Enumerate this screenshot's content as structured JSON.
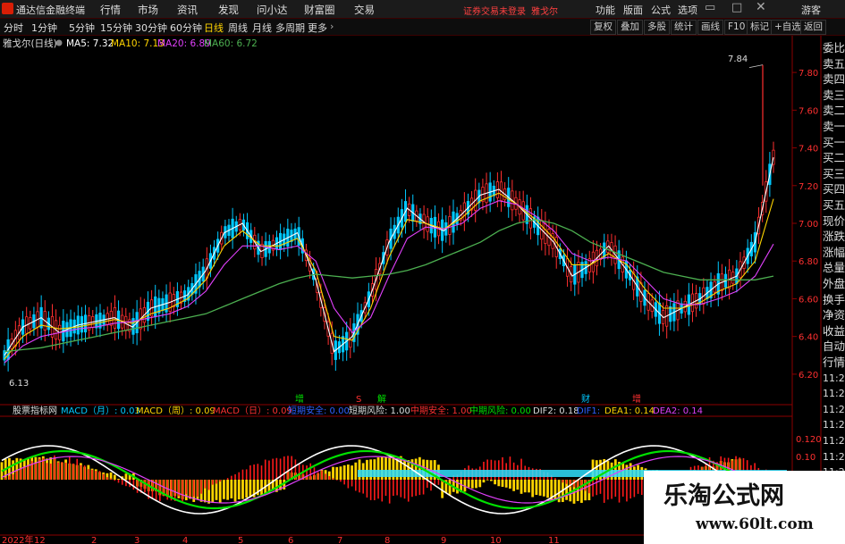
{
  "app": {
    "name": "通达信金融终端"
  },
  "menu": [
    "行情",
    "市场",
    "资讯",
    "发现",
    "问小达",
    "财富圈",
    "交易"
  ],
  "notice": "证券交易未登录",
  "stock_name_top": "雅戈尔",
  "right_menu": [
    "功能",
    "版面",
    "公式",
    "选项"
  ],
  "guest": "游客",
  "periods": [
    "分时",
    "1分钟",
    "5分钟",
    "15分钟",
    "30分钟",
    "60分钟",
    "日线",
    "周线",
    "月线",
    "多周期",
    "更多"
  ],
  "active_period": "日线",
  "tools": [
    "复权",
    "叠加",
    "多股",
    "统计",
    "画线",
    "F10",
    "标记",
    "+自选",
    "返回"
  ],
  "main_legend": {
    "title": "雅戈尔(日线)",
    "ma5": "MA5: 7.32",
    "ma10": "MA10: 7.13",
    "ma20": "MA20: 6.89",
    "ma60": "MA60: 6.72"
  },
  "colors": {
    "ma5": "#ffffff",
    "ma10": "#ffd400",
    "ma20": "#e040fb",
    "ma60": "#4caf50",
    "up": "#ff3030",
    "down": "#00c8ff",
    "accent": "#ff3030"
  },
  "price_axis": [
    "7.80",
    "7.60",
    "7.40",
    "7.20",
    "7.00",
    "6.80",
    "6.60",
    "6.40",
    "6.20"
  ],
  "high_label": "7.84",
  "low_label": "6.13",
  "event_markers": [
    {
      "text": "增",
      "color": "#00e000"
    },
    {
      "text": "S",
      "color": "#ff3030"
    },
    {
      "text": "解",
      "color": "#00e000"
    },
    {
      "text": "财",
      "color": "#00c8ff"
    },
    {
      "text": "增",
      "color": "#ff3030"
    }
  ],
  "sub_legend": {
    "title": "股票指标网",
    "items": [
      {
        "text": "MACD（月）: 0.03",
        "color": "#00c8ff"
      },
      {
        "text": "MACD（周）: 0.09",
        "color": "#ffd400"
      },
      {
        "text": "MACD（日）: 0.09",
        "color": "#ff3030"
      },
      {
        "text": "短期安全: 0.00",
        "color": "#3060ff"
      },
      {
        "text": "短期风险: 1.00",
        "color": "#dddddd"
      },
      {
        "text": "中期安全: 1.00",
        "color": "#ff3030"
      },
      {
        "text": "中期风险: 0.00",
        "color": "#00e000"
      },
      {
        "text": "DIF2: 0.18",
        "color": "#dddddd"
      },
      {
        "text": "DIF1: ",
        "color": "#3060ff"
      },
      {
        "text": "DEA1: 0.14",
        "color": "#ffd400"
      },
      {
        "text": "DEA2: 0.14",
        "color": "#e040fb"
      }
    ]
  },
  "sub_axis": [
    "0.120",
    "0.10"
  ],
  "right_quote_labels": [
    "委比",
    "卖五",
    "卖四",
    "卖三",
    "卖二",
    "卖一",
    "买一",
    "买二",
    "买三",
    "买四",
    "买五",
    "现价",
    "涨跌",
    "涨幅",
    "总量",
    "外盘",
    "换手",
    "净资",
    "收益",
    "自动",
    "行情",
    "11:29",
    "11:29",
    "11:29",
    "11:29",
    "11:29",
    "11:29",
    "11:29",
    "11:29",
    "11:29",
    "11:29"
  ],
  "date_axis": [
    "2022年",
    "12",
    "2",
    "3",
    "4",
    "5",
    "6",
    "7",
    "8",
    "9",
    "10",
    "11"
  ],
  "watermark": {
    "title": "乐淘公式网",
    "url": "www.60lt.com"
  },
  "chart_data": {
    "type": "line",
    "title": "雅戈尔(日线)",
    "ylim": [
      6.1,
      7.9
    ],
    "series": [
      {
        "name": "MA5",
        "values": [
          6.3,
          6.45,
          6.5,
          6.42,
          6.46,
          6.48,
          6.5,
          6.45,
          6.55,
          6.58,
          6.62,
          6.75,
          6.95,
          7.0,
          6.85,
          6.9,
          6.95,
          6.7,
          6.32,
          6.4,
          6.62,
          6.9,
          7.08,
          7.0,
          6.96,
          7.05,
          7.15,
          7.18,
          7.1,
          7.0,
          6.9,
          6.72,
          6.78,
          6.88,
          6.75,
          6.6,
          6.5,
          6.55,
          6.6,
          6.68,
          6.72,
          6.9,
          7.35
        ]
      },
      {
        "name": "MA10",
        "values": [
          6.28,
          6.4,
          6.46,
          6.44,
          6.45,
          6.47,
          6.49,
          6.47,
          6.52,
          6.55,
          6.6,
          6.7,
          6.88,
          6.96,
          6.88,
          6.88,
          6.92,
          6.75,
          6.4,
          6.38,
          6.55,
          6.82,
          7.02,
          7.0,
          6.97,
          7.03,
          7.12,
          7.16,
          7.1,
          7.02,
          6.92,
          6.78,
          6.78,
          6.84,
          6.78,
          6.65,
          6.55,
          6.55,
          6.58,
          6.64,
          6.68,
          6.8,
          7.13
        ]
      },
      {
        "name": "MA20",
        "values": [
          6.26,
          6.35,
          6.4,
          6.42,
          6.44,
          6.45,
          6.47,
          6.48,
          6.5,
          6.52,
          6.56,
          6.64,
          6.78,
          6.88,
          6.88,
          6.86,
          6.88,
          6.8,
          6.55,
          6.42,
          6.5,
          6.72,
          6.92,
          6.98,
          6.97,
          7.0,
          7.08,
          7.12,
          7.1,
          7.04,
          6.96,
          6.84,
          6.8,
          6.82,
          6.8,
          6.7,
          6.6,
          6.57,
          6.57,
          6.6,
          6.64,
          6.72,
          6.89
        ]
      },
      {
        "name": "MA60",
        "values": [
          6.32,
          6.33,
          6.34,
          6.36,
          6.38,
          6.4,
          6.42,
          6.44,
          6.46,
          6.48,
          6.5,
          6.52,
          6.56,
          6.6,
          6.64,
          6.68,
          6.71,
          6.73,
          6.72,
          6.71,
          6.72,
          6.73,
          6.75,
          6.78,
          6.82,
          6.86,
          6.9,
          6.96,
          7.0,
          7.02,
          7.0,
          6.96,
          6.9,
          6.86,
          6.82,
          6.78,
          6.74,
          6.72,
          6.7,
          6.7,
          6.7,
          6.7,
          6.72
        ]
      }
    ],
    "high": 7.84,
    "low": 6.13
  }
}
